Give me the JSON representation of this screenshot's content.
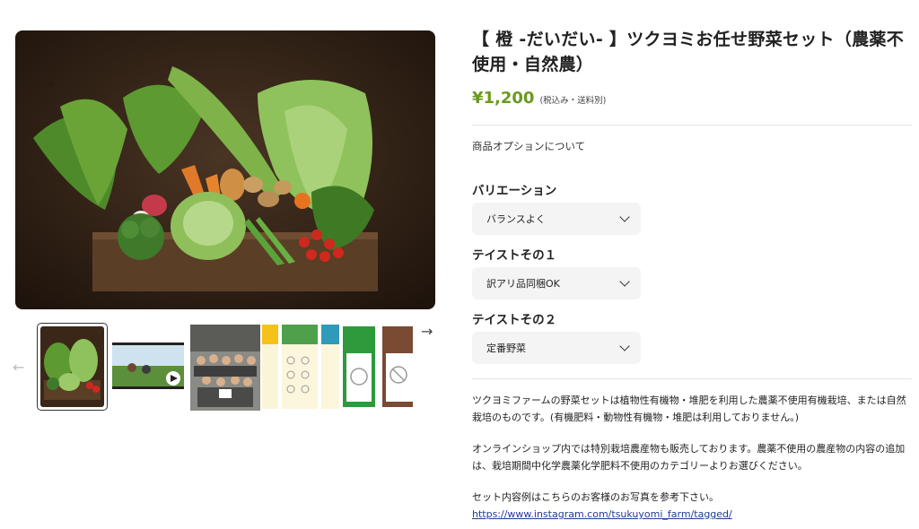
{
  "product": {
    "title": "【 橙 -だいだい- 】ツクヨミお任せ野菜セット（農薬不使用・自然農）",
    "price": "¥1,200",
    "price_note": "(税込み・送料別)",
    "options_link": "商品オプションについて"
  },
  "options": [
    {
      "label": "バリエーション",
      "selected": "バランスよく"
    },
    {
      "label": "テイストその１",
      "selected": "訳アリ品同梱OK"
    },
    {
      "label": "テイストその２",
      "selected": "定番野菜"
    }
  ],
  "description": {
    "p1": "ツクヨミファームの野菜セットは植物性有機物・堆肥を利用した農薬不使用有機栽培、または自然栽培のものです。(有機肥料・動物性有機物・堆肥は利用しておりません。)",
    "p2": "オンラインショップ内では特別栽培農産物も販売しております。農薬不使用の農産物の内容の追加は、栽培期間中化学農薬化学肥料不使用のカテゴリーよりお選びください。",
    "p3": "セット内容例はこちらのお客様のお写真を参考下さい。",
    "link": "https://www.instagram.com/tsukuyomi_farm/tagged/"
  },
  "gallery": {
    "prev_icon": "arrow-left-icon",
    "next_icon": "arrow-right-icon",
    "thumbnails": [
      "vegetable-box",
      "video-farm",
      "group-photo",
      "size-chart",
      "green-card",
      "brown-card"
    ]
  },
  "colors": {
    "price": "#6a9a1f",
    "link": "#1b3f8f",
    "select_bg": "#f4f4f4"
  }
}
